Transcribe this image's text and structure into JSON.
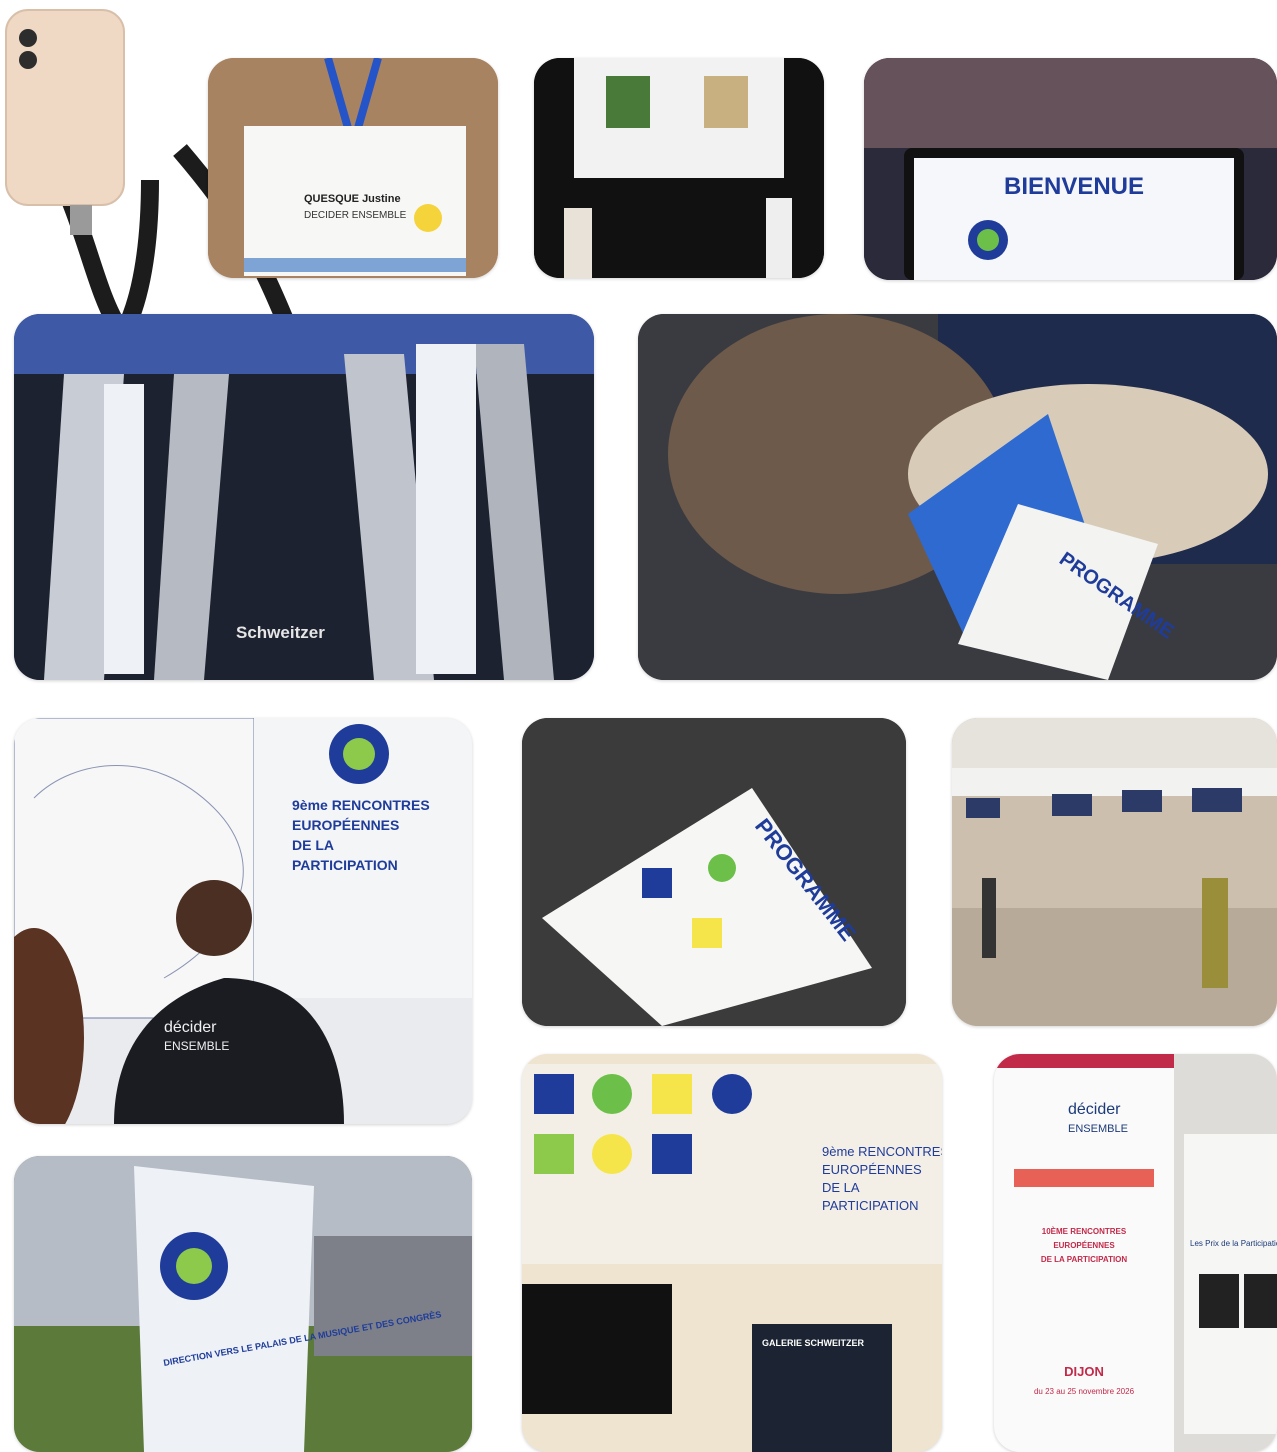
{
  "event": {
    "edition_name": "9ème RENCONTRES EUROPÉENNES DE LA PARTICIPATION",
    "line1": "9ème RENCONTRES",
    "line2": "EUROPÉENNES",
    "line3": "DE LA",
    "line4": "PARTICIPATION",
    "next_edition_line1": "10ÈME RENCONTRES",
    "next_edition_line2": "EUROPÉENNES",
    "next_edition_line3": "DE LA PARTICIPATION"
  },
  "badge": {
    "name": "QUESQUE Justine",
    "org": "DECIDER ENSEMBLE"
  },
  "brand": {
    "name_top": "décider",
    "name_bottom": "ENSEMBLE"
  },
  "screens": {
    "welcome": "BIENVENUE",
    "program": "PROGRAMME",
    "gallery": "GALERIE SCHWEITZER",
    "venue": "Schweitzer",
    "direction": "DIRECTION VERS LE PALAIS DE LA MUSIQUE ET DES CONGRÈS",
    "city": "DIJON",
    "dates": "du 23 au 25 novembre 2026",
    "prix": "Les Prix de la Participation"
  },
  "colors": {
    "blue": "#1f3c9b",
    "green": "#5fb63b",
    "yellow": "#f5e44a",
    "navy": "#0d1a4d",
    "red": "#e23b2d"
  }
}
